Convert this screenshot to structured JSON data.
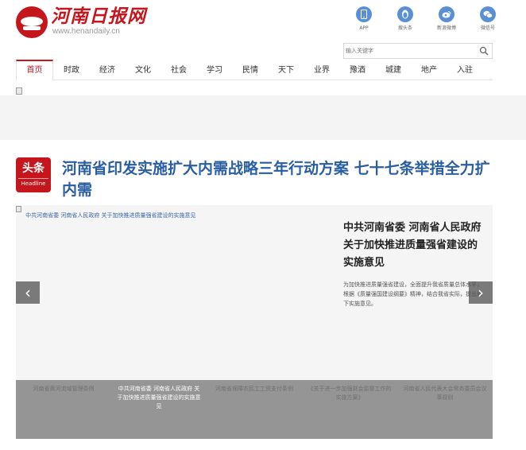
{
  "header": {
    "logo_text": "河南日报网",
    "logo_url": "www.henandaily.cn",
    "apps": [
      {
        "label": "APP",
        "icon": "phone-icon"
      },
      {
        "label": "搜头条",
        "icon": "penguin-icon"
      },
      {
        "label": "新浪微博",
        "icon": "weibo-icon"
      },
      {
        "label": "微信号",
        "icon": "wechat-icon"
      }
    ],
    "search_placeholder": "输入关键字"
  },
  "nav": {
    "items": [
      "首页",
      "时政",
      "经济",
      "文化",
      "社会",
      "学习",
      "民情",
      "天下",
      "业界",
      "豫酒",
      "城建",
      "地产",
      "入驻"
    ],
    "active_index": 0
  },
  "headline": {
    "badge_cn": "头条",
    "badge_en": "Headline",
    "title": "河南省印发实施扩大内需战略三年行动方案 七十七条举措全力扩内需"
  },
  "carousel": {
    "image_alt": "中共河南省委 河南省人民政府 关于加快推进质量强省建设的实施意见",
    "slide_title": "中共河南省委 河南省人民政府 关于加快推进质量强省建设的实施意见",
    "slide_summary": "为加快推进质量强省建设，全面提升我省质量总体水平，根据《质量强国建设纲要》精神，结合我省实际，提出如下实施意见。",
    "prev_label": "‹",
    "next_label": "›",
    "thumbnails": [
      "河南省黄河流域管理条例",
      "中共河南省委 河南省人民政府 关于加快推进质量强省建设的实施意见",
      "河南省保障农民工工资支付条例",
      "《关于进一步加强财会监督工作的实施方案》",
      "河南省人民代表大会常务委员会议事规则"
    ],
    "active_thumb": 1
  },
  "colors": {
    "brand_red": "#c4161c",
    "headline_blue": "#2a5ea3",
    "app_icon_blue": "#5b8fd3"
  }
}
